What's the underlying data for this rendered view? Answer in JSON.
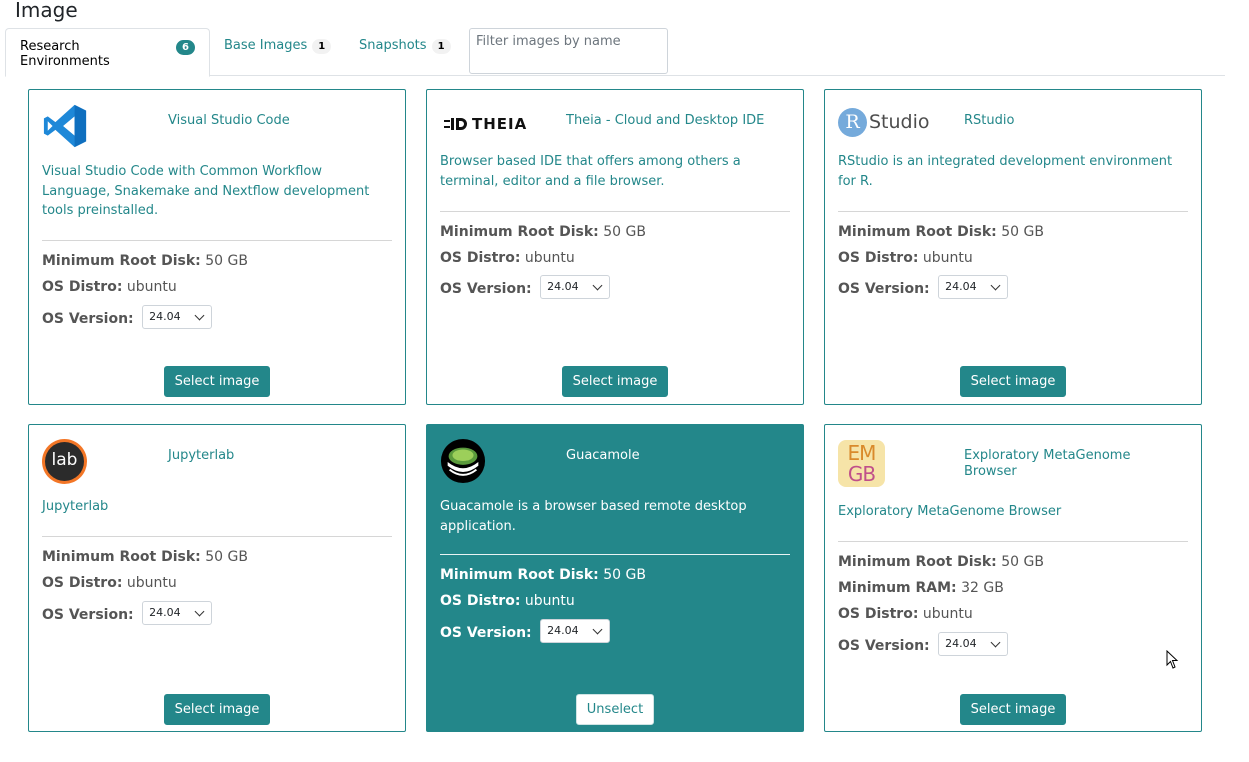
{
  "page": {
    "title": "Image"
  },
  "tabs": [
    {
      "label": "Research Environments",
      "count": "6"
    },
    {
      "label": "Base Images",
      "count": "1"
    },
    {
      "label": "Snapshots",
      "count": "1"
    }
  ],
  "filter": {
    "placeholder": "Filter images by name"
  },
  "labels": {
    "min_root_disk": "Minimum Root Disk:",
    "min_ram": "Minimum RAM:",
    "os_distro": "OS Distro:",
    "os_version": "OS Version:",
    "select": "Select image",
    "unselect": "Unselect"
  },
  "cards": [
    {
      "name": "Visual Studio Code",
      "description": "Visual Studio Code with Common Workflow Language, Snakemake and Nextflow development tools preinstalled.",
      "min_root_disk": "50 GB",
      "os_distro": "ubuntu",
      "os_version": "24.04",
      "logo_icon": "vscode-icon"
    },
    {
      "name": "Theia - Cloud and Desktop IDE",
      "description": "Browser based IDE that offers among others a terminal, editor and a file browser.",
      "min_root_disk": "50 GB",
      "os_distro": "ubuntu",
      "os_version": "24.04",
      "logo_icon": "theia-logo",
      "logo_text": "THEIA"
    },
    {
      "name": "RStudio",
      "description": "RStudio is an integrated development environment for R.",
      "min_root_disk": "50 GB",
      "os_distro": "ubuntu",
      "os_version": "24.04",
      "logo_icon": "rstudio-logo",
      "logo_text": "Studio",
      "logo_letter": "R"
    },
    {
      "name": "Jupyterlab",
      "description": "Jupyterlab",
      "min_root_disk": "50 GB",
      "os_distro": "ubuntu",
      "os_version": "24.04",
      "logo_icon": "jupyterlab-logo",
      "logo_text": "lab"
    },
    {
      "name": "Guacamole",
      "description": "Guacamole is a browser based remote desktop application.",
      "min_root_disk": "50 GB",
      "os_distro": "ubuntu",
      "os_version": "24.04",
      "selected": true,
      "logo_icon": "guacamole-logo"
    },
    {
      "name": "Exploratory MetaGenome Browser",
      "description": "Exploratory MetaGenome Browser",
      "min_root_disk": "50 GB",
      "min_ram": "32 GB",
      "os_distro": "ubuntu",
      "os_version": "24.04",
      "logo_icon": "emgb-logo",
      "logo_text_top": "EM",
      "logo_text_bottom": "GB"
    }
  ],
  "colors": {
    "accent": "#23878a",
    "border": "#dee2e6",
    "text": "#212529",
    "muted": "#555555"
  }
}
